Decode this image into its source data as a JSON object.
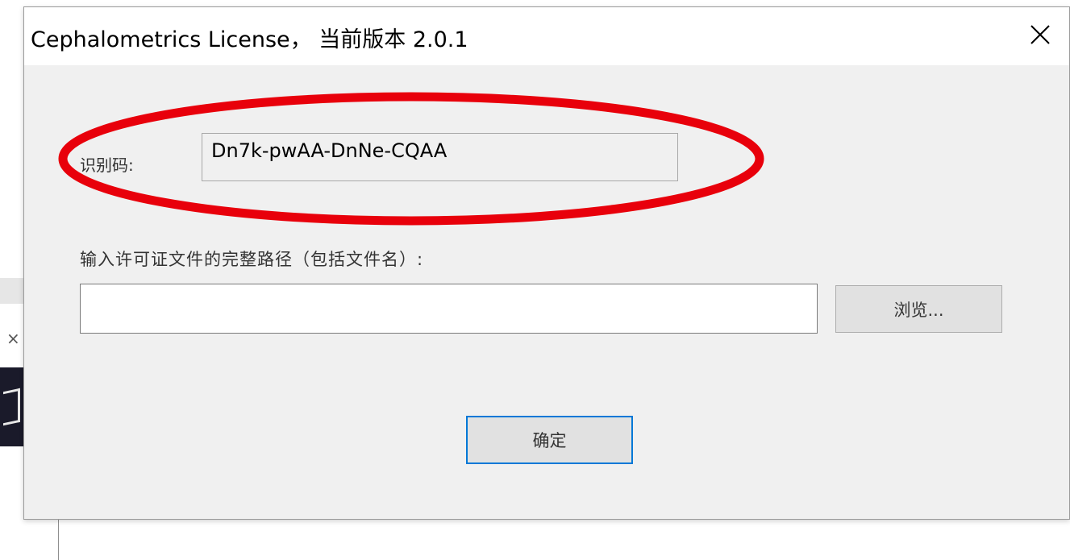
{
  "dialog": {
    "title": "Cephalometrics License， 当前版本 2.0.1",
    "close_icon": "close-icon"
  },
  "identification": {
    "label": "识别码:",
    "value": "Dn7k-pwAA-DnNe-CQAA",
    "highlight_color": "#e8000b"
  },
  "license_path": {
    "label": "输入许可证文件的完整路径（包括文件名）:",
    "value": "",
    "placeholder": ""
  },
  "buttons": {
    "browse_label": "浏览...",
    "ok_label": "确定",
    "ok_focus_color": "#0078d7"
  },
  "background": {
    "close_mark": "×"
  }
}
